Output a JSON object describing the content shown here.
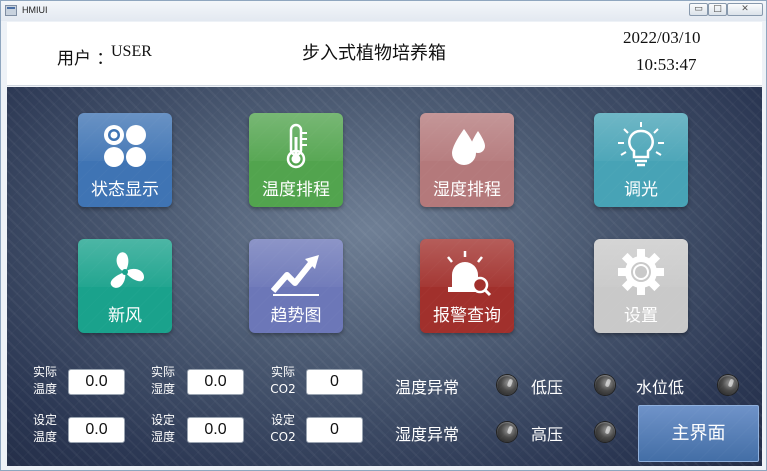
{
  "window": {
    "title": "HMIUI",
    "minimize_glyph": "▭",
    "maximize_glyph": "□",
    "close_glyph": "✕"
  },
  "header": {
    "user_label": "用户 ：",
    "user_name": "USER",
    "title": "步入式植物培养箱",
    "date": "2022/03/10",
    "time": "10:53:47"
  },
  "tiles": [
    {
      "label": "状态显示",
      "icon": "status-circles-icon",
      "color": "#3f74b4"
    },
    {
      "label": "温度排程",
      "icon": "thermometer-icon",
      "color": "#52a44e"
    },
    {
      "label": "湿度排程",
      "icon": "water-drops-icon",
      "color": "#b4797b"
    },
    {
      "label": "调光",
      "icon": "light-bulb-icon",
      "color": "#47a3b6"
    },
    {
      "label": "新风",
      "icon": "fan-icon",
      "color": "#1aa28c"
    },
    {
      "label": "趋势图",
      "icon": "trend-chart-icon",
      "color": "#6c77b8"
    },
    {
      "label": "报警查询",
      "icon": "alarm-siren-icon",
      "color": "#a1302c"
    },
    {
      "label": "设置",
      "icon": "gear-icon",
      "color": "#c9c9c9"
    }
  ],
  "readings": {
    "actual": [
      {
        "label_top": "实际",
        "label_bottom": "温度",
        "value": "0.0"
      },
      {
        "label_top": "实际",
        "label_bottom": "湿度",
        "value": "0.0"
      },
      {
        "label_top": "实际",
        "label_bottom": "CO2",
        "value": "0"
      }
    ],
    "setpoint": [
      {
        "label_top": "设定",
        "label_bottom": "温度",
        "value": "0.0"
      },
      {
        "label_top": "设定",
        "label_bottom": "湿度",
        "value": "0.0"
      },
      {
        "label_top": "设定",
        "label_bottom": "CO2",
        "value": "0"
      }
    ]
  },
  "alarms": [
    {
      "label": "温度异常",
      "state": "off"
    },
    {
      "label": "低压",
      "state": "off"
    },
    {
      "label": "水位低",
      "state": "off"
    },
    {
      "label": "湿度异常",
      "state": "off"
    },
    {
      "label": "高压",
      "state": "off"
    }
  ],
  "home_button": {
    "label": "主界面"
  }
}
